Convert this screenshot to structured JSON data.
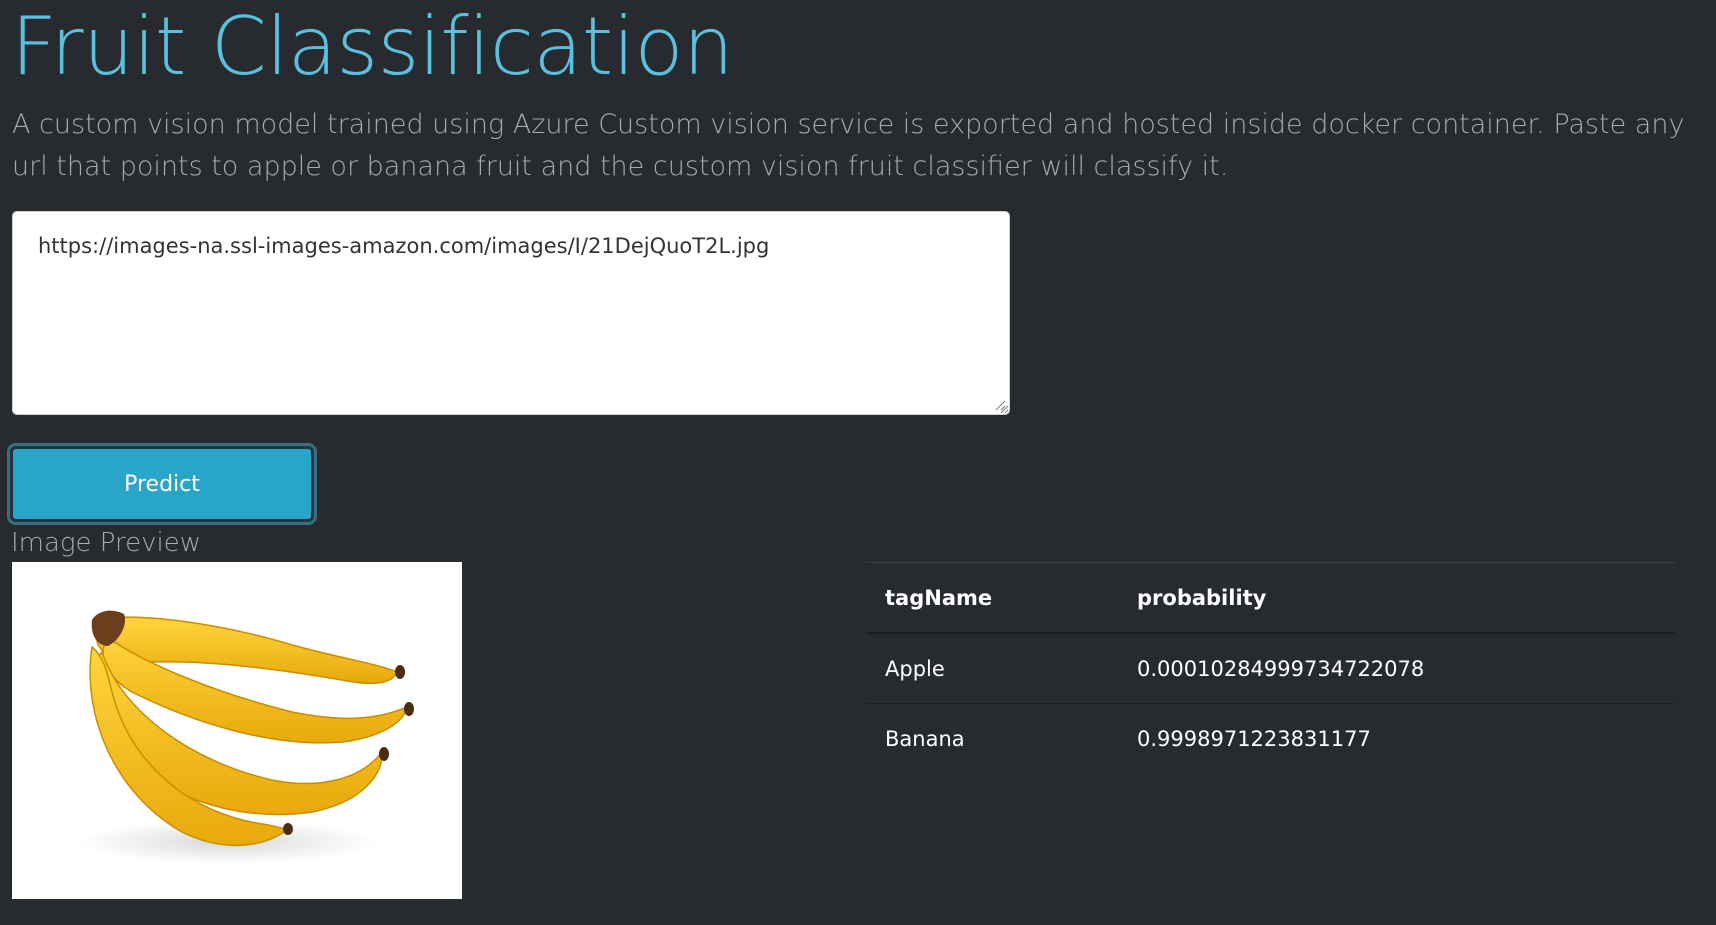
{
  "header": {
    "title": "Fruit Classification",
    "description": "A custom vision model trained using Azure Custom vision service is exported and hosted inside docker container. Paste any url that points to apple or banana fruit and the custom vision fruit classifier will classify it."
  },
  "form": {
    "url_value": "https://images-na.ssl-images-amazon.com/images/I/21DejQuoT2L.jpg",
    "predict_label": "Predict"
  },
  "preview": {
    "label": "Image Preview"
  },
  "results": {
    "columns": [
      "tagName",
      "probability"
    ],
    "rows": [
      {
        "tagName": "Apple",
        "probability": "0.00010284999734722078"
      },
      {
        "tagName": "Banana",
        "probability": "0.9998971223831177"
      }
    ]
  },
  "colors": {
    "background": "#272b30",
    "title": "#5bc0de",
    "button": "#2aa5ca",
    "banana_yellow": "#f5c518"
  }
}
